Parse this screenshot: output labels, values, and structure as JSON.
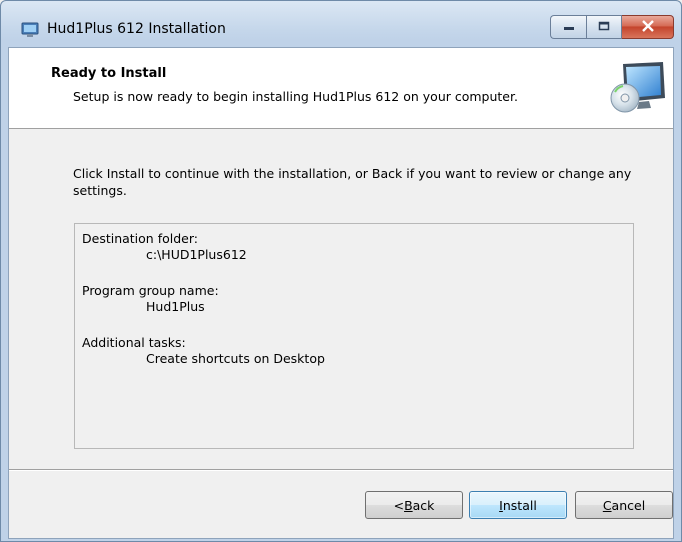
{
  "window": {
    "title": "Hud1Plus 612 Installation",
    "icon": "installer-app-icon",
    "controls": [
      "minimize-icon",
      "maximize-icon",
      "close-icon"
    ]
  },
  "header": {
    "title": "Ready to Install",
    "subtitle": "Setup is now ready to begin installing Hud1Plus 612 on your computer.",
    "icon": "install-disc-monitor-icon"
  },
  "intro": "Click Install to continue with the installation, or Back if you want to review or change any settings.",
  "summary": {
    "destination_label": "Destination folder:",
    "destination_value": "c:\\HUD1Plus612",
    "group_label": "Program group name:",
    "group_value": "Hud1Plus",
    "tasks_label": "Additional tasks:",
    "tasks_value": "Create shortcuts on Desktop"
  },
  "buttons": {
    "back": {
      "prefix": "< ",
      "accel": "B",
      "rest": "ack"
    },
    "install": {
      "prefix": "",
      "accel": "I",
      "rest": "nstall"
    },
    "cancel": {
      "prefix": "",
      "accel": "C",
      "rest": "ancel"
    }
  },
  "colors": {
    "default_button_border": "#3c7fb1",
    "close_button": "#c4442c"
  }
}
